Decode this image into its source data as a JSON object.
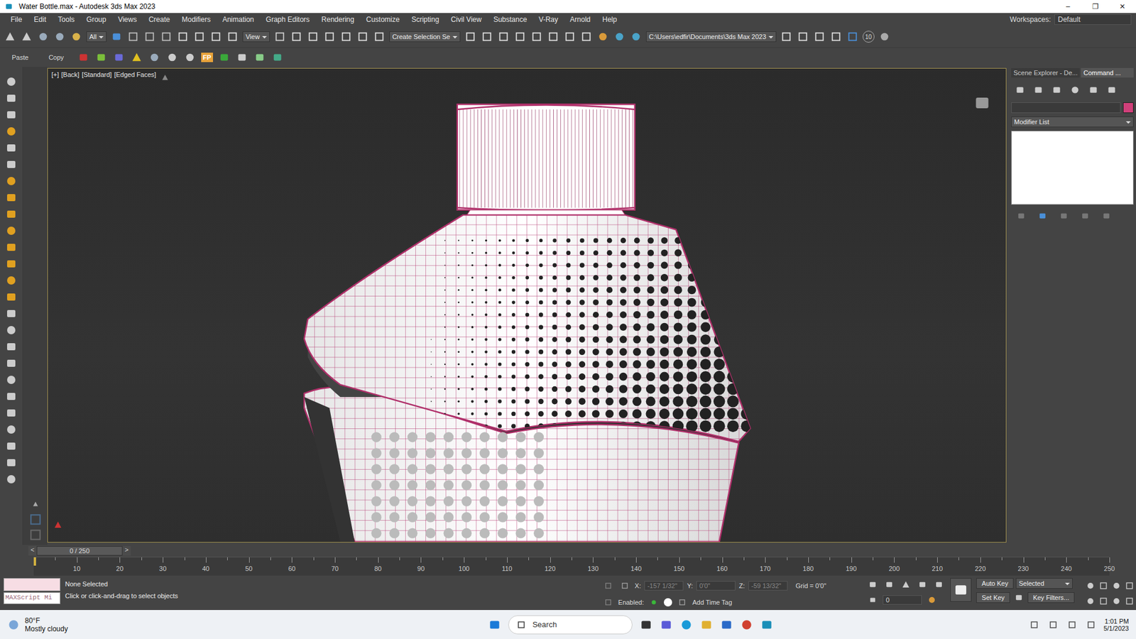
{
  "window": {
    "title": "Water Bottle.max - Autodesk 3ds Max 2023",
    "controls": [
      "–",
      "❐",
      "✕"
    ]
  },
  "menu": {
    "items": [
      "File",
      "Edit",
      "Tools",
      "Group",
      "Views",
      "Create",
      "Modifiers",
      "Animation",
      "Graph Editors",
      "Rendering",
      "Customize",
      "Scripting",
      "Civil View",
      "Substance",
      "V-Ray",
      "Arnold",
      "Help"
    ],
    "workspace_label": "Workspaces:",
    "workspace": "Default"
  },
  "toolbar": {
    "filter": "All",
    "coord": "View",
    "selection_set": "Create Selection Se",
    "path": "C:\\Users\\edfir\\Documents\\3ds Max 2023",
    "badge": "10"
  },
  "toolbar2": {
    "paste": "Paste",
    "copy": "Copy",
    "fp": "FP"
  },
  "viewport": {
    "label": [
      "[+]",
      "[Back]",
      "[Standard]",
      "[Edged Faces]"
    ]
  },
  "command_panel": {
    "tabs": [
      {
        "label": "Scene Explorer - De...",
        "selected": false
      },
      {
        "label": "Command ...",
        "selected": true
      }
    ],
    "modifier_list": "Modifier List"
  },
  "timeline": {
    "frame": "0 / 250",
    "prev": "<",
    "next": ">",
    "level": 0,
    "ticks": [
      "10",
      "20",
      "30",
      "40",
      "50",
      "60",
      "70",
      "80",
      "90",
      "100",
      "110",
      "120",
      "130",
      "140",
      "150",
      "160",
      "170",
      "180",
      "190",
      "200",
      "210",
      "220",
      "230",
      "240",
      "250"
    ]
  },
  "status": {
    "listener": "MAXScript Mi",
    "selection": "None Selected",
    "prompt": "Click or click-and-drag to select objects",
    "x_label": "X:",
    "x": "-157 1/32\"",
    "y_label": "Y:",
    "y": "0'0\"",
    "z_label": "Z:",
    "z": "-59 13/32\"",
    "grid": "Grid = 0'0\"",
    "enabled": "Enabled:",
    "add_time_tag": "Add Time Tag",
    "auto_key": "Auto Key",
    "key_mode": "Selected",
    "set_key": "Set Key",
    "key_filters": "Key Filters...",
    "current_frame": "0"
  },
  "taskbar": {
    "temp": "80°F",
    "weather": "Mostly cloudy",
    "search": "Search",
    "time": "1:01 PM",
    "date": "5/1/2023"
  }
}
